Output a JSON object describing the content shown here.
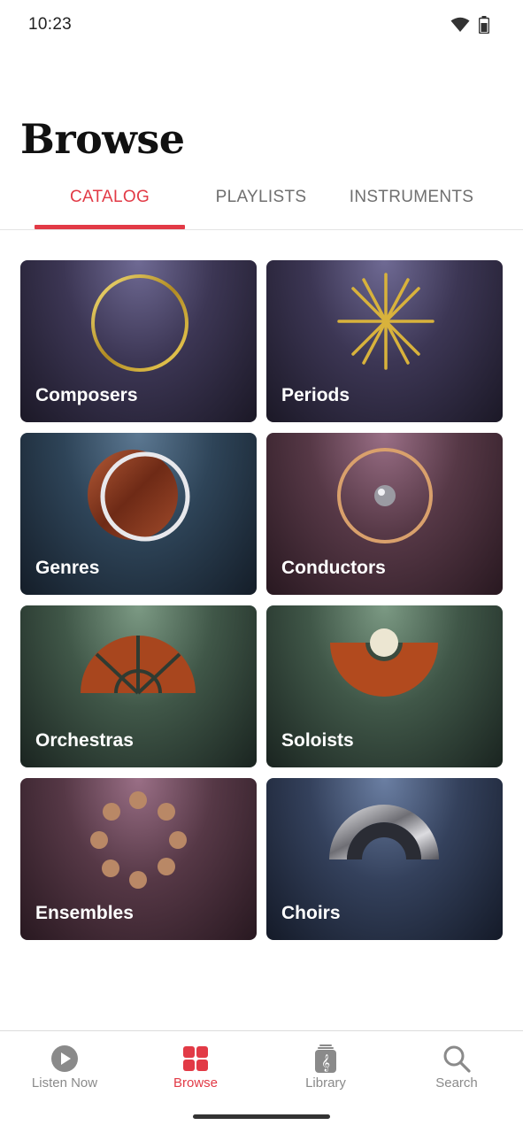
{
  "status_bar": {
    "time": "10:23",
    "icons": [
      "wifi-icon",
      "battery-icon"
    ]
  },
  "page": {
    "title": "Browse"
  },
  "tabs": [
    {
      "label": "CATALOG",
      "active": true
    },
    {
      "label": "PLAYLISTS",
      "active": false
    },
    {
      "label": "INSTRUMENTS",
      "active": false
    }
  ],
  "categories": [
    {
      "label": "Composers",
      "icon": "gold-ring-icon"
    },
    {
      "label": "Periods",
      "icon": "gold-star-icon"
    },
    {
      "label": "Genres",
      "icon": "wood-disc-icon"
    },
    {
      "label": "Conductors",
      "icon": "ring-with-bead-icon"
    },
    {
      "label": "Orchestras",
      "icon": "half-circle-fan-icon"
    },
    {
      "label": "Soloists",
      "icon": "arc-with-pearl-icon"
    },
    {
      "label": "Ensembles",
      "icon": "circle-of-discs-icon"
    },
    {
      "label": "Choirs",
      "icon": "metal-dome-icon"
    }
  ],
  "bottom_nav": [
    {
      "label": "Listen Now",
      "icon": "play-icon",
      "active": false
    },
    {
      "label": "Browse",
      "icon": "grid-icon",
      "active": true
    },
    {
      "label": "Library",
      "icon": "library-icon",
      "active": false
    },
    {
      "label": "Search",
      "icon": "search-icon",
      "active": false
    }
  ],
  "colors": {
    "accent": "#e23a46",
    "inactive": "#8a8a8a"
  }
}
